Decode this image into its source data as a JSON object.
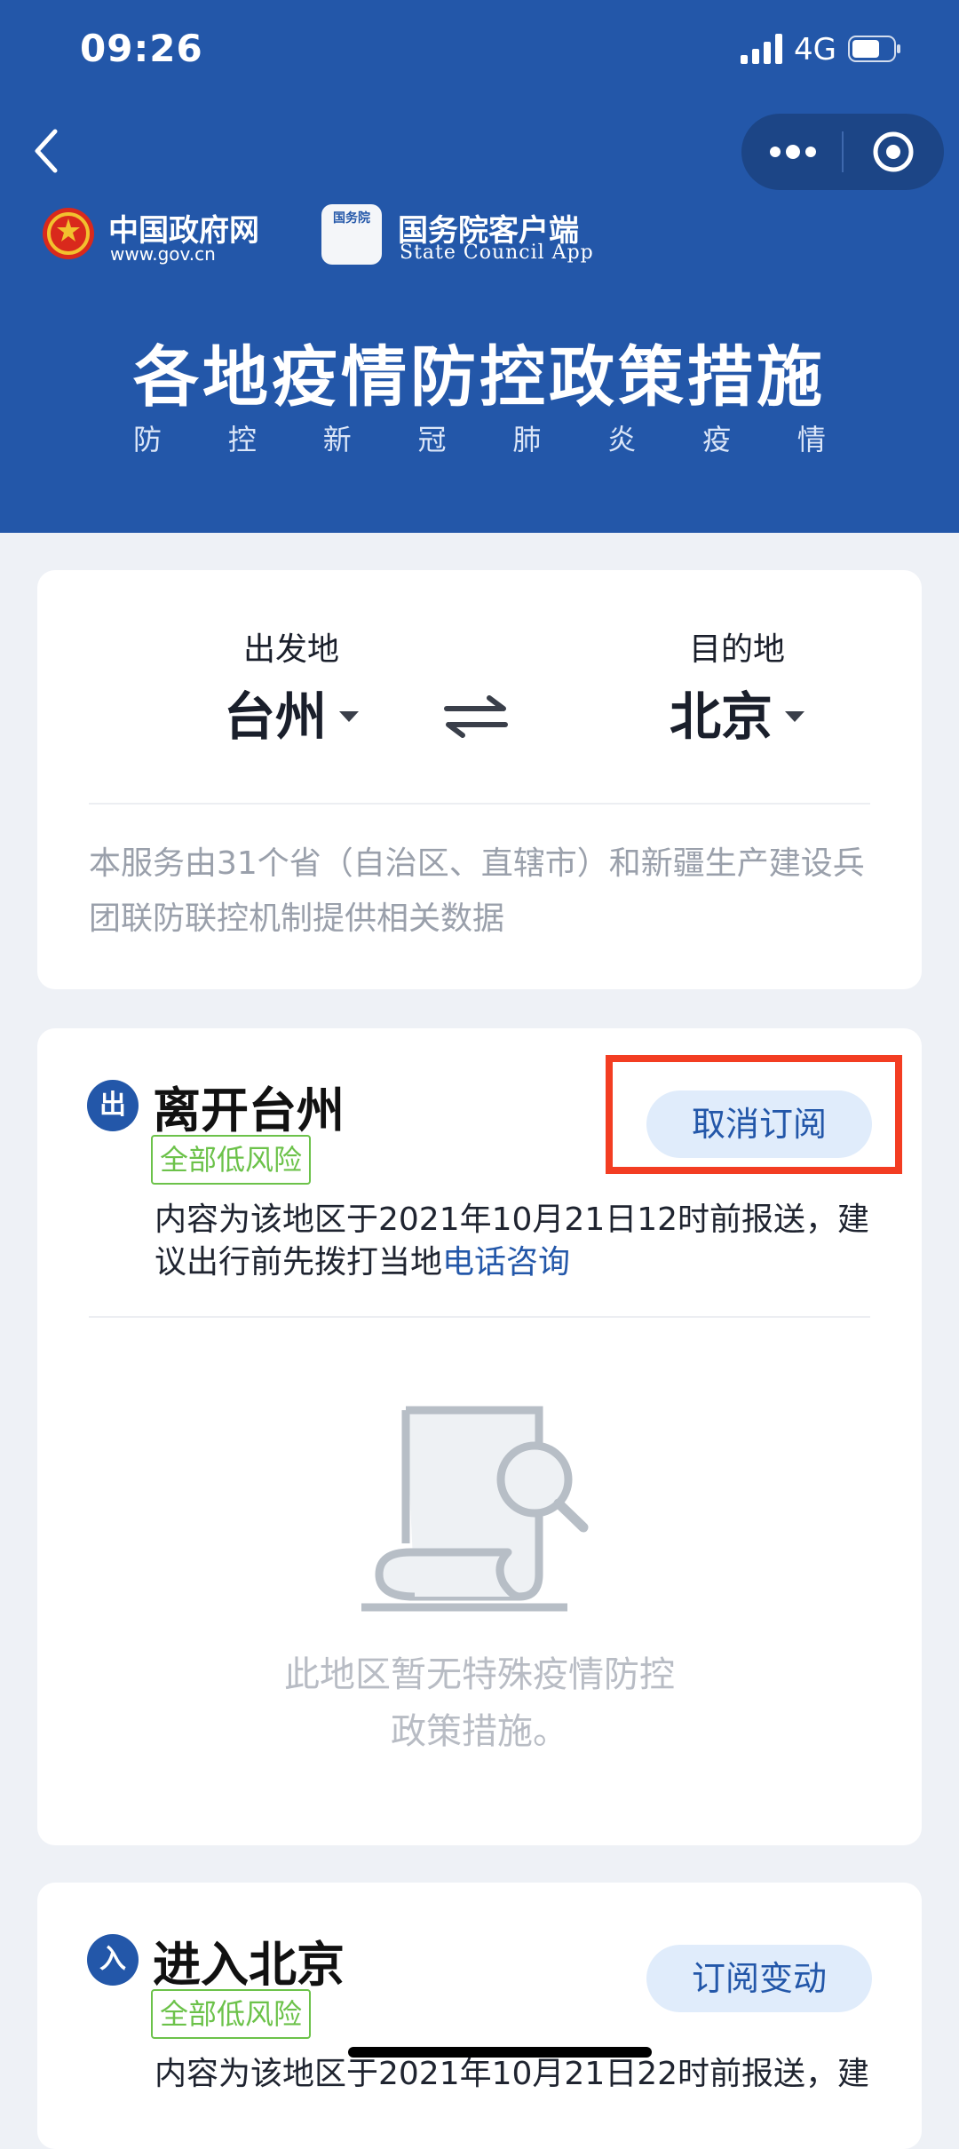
{
  "status_bar": {
    "time": "09:26",
    "network": "4G"
  },
  "header": {
    "gov_name": "中国政府网",
    "gov_url": "www.gov.cn",
    "app_icon_text": "国务院",
    "app_name": "国务院客户端",
    "app_name_en": "State Council App",
    "title": "各地疫情防控政策措施",
    "subtitle_chars": [
      "防",
      "控",
      "新",
      "冠",
      "肺",
      "炎",
      "疫",
      "情"
    ]
  },
  "route": {
    "from_label": "出发地",
    "from_value": "台州",
    "to_label": "目的地",
    "to_value": "北京",
    "note": "本服务由31个省（自治区、直辖市）和新疆生产建设兵团联防联控机制提供相关数据"
  },
  "exit_section": {
    "badge": "出",
    "title": "离开台州",
    "risk": "全部低风险",
    "button": "取消订阅",
    "note_prefix": "内容为该地区于2021年10月21日12时前报送，建议出行前先拨打当地",
    "note_link": "电话咨询",
    "empty_line1": "此地区暂无特殊疫情防控",
    "empty_line2": "政策措施。"
  },
  "enter_section": {
    "badge": "入",
    "title": "进入北京",
    "risk": "全部低风险",
    "button": "订阅变动",
    "note_prefix": "内容为该地区于2021年10月21日22时前报送，建"
  },
  "colors": {
    "brand_blue": "#2357a9",
    "risk_green": "#6cc24a",
    "highlight_red": "#f33d22"
  }
}
